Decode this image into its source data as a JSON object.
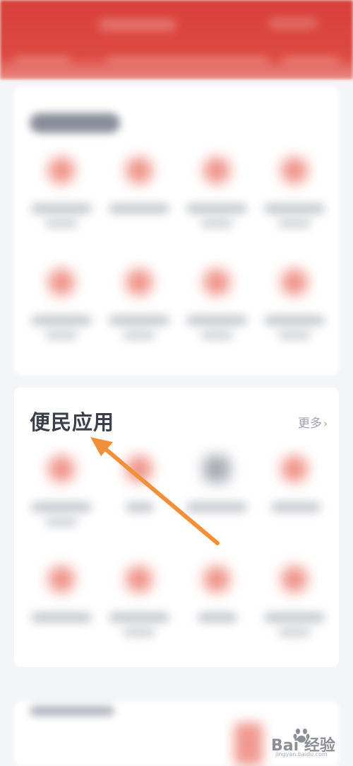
{
  "section": {
    "title": "便民应用",
    "more_label": "更多",
    "more_chevron": "›"
  },
  "watermark": {
    "brand": "Bai 经验",
    "url": "jingyan.baidu.com"
  },
  "colors": {
    "header_red": "#d8403a",
    "annotation_arrow": "#f0913a",
    "title_text": "#3a3f4b",
    "more_text": "#9ea3ad"
  }
}
